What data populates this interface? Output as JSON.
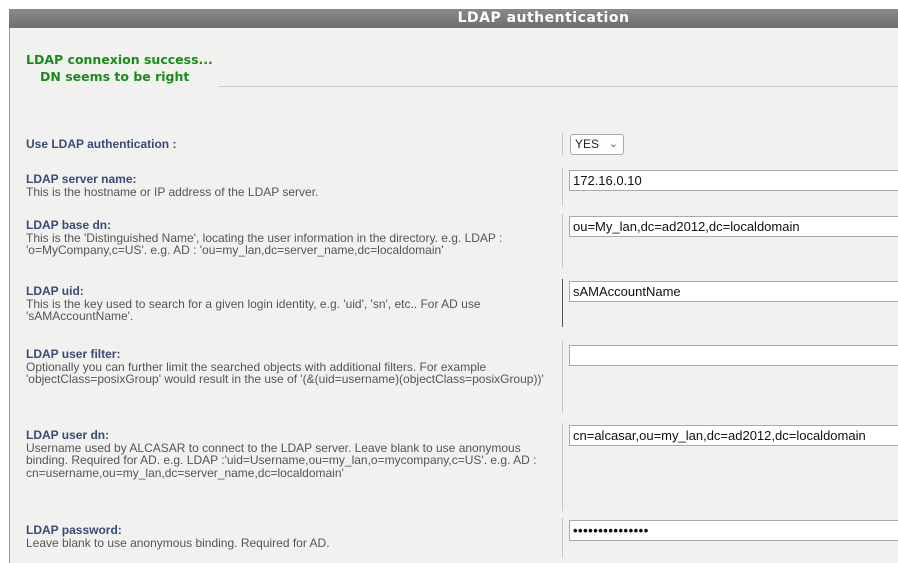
{
  "window": {
    "title": "LDAP authentication"
  },
  "status": {
    "line1": "LDAP connexion success...",
    "line2": "DN seems to be right"
  },
  "settings": [
    {
      "title": "Use LDAP authentication :",
      "description": "",
      "control": "select",
      "value": "YES"
    },
    {
      "title": "LDAP server name:",
      "description": "This is the hostname or IP address of the LDAP server.",
      "control": "text",
      "value": "172.16.0.10"
    },
    {
      "title": "LDAP base dn:",
      "description": "This is the 'Distinguished Name', locating the user information in the directory. e.g. LDAP : 'o=MyCompany,c=US'. e.g. AD : 'ou=my_lan,dc=server_name,dc=localdomain'",
      "control": "text",
      "value": "ou=My_lan,dc=ad2012,dc=localdomain"
    },
    {
      "title": "LDAP uid:",
      "description": "This is the key used to search for a given login identity, e.g. 'uid', 'sn', etc.. For AD use 'sAMAccountName'.",
      "control": "text",
      "value": "sAMAccountName"
    },
    {
      "title": "LDAP user filter:",
      "description": "Optionally you can further limit the searched objects with additional filters. For example 'objectClass=posixGroup' would result in the use of '(&(uid=username)(objectClass=posixGroup))'",
      "control": "text",
      "value": ""
    },
    {
      "title": "LDAP user dn:",
      "description": "Username used by ALCASAR to connect to the LDAP server. Leave blank to use anonymous binding. Required for AD. e.g. LDAP :'uid=Username,ou=my_lan,o=mycompany,c=US'. e.g. AD : cn=username,ou=my_lan,dc=server_name,dc=localdomain'",
      "control": "text",
      "value": "cn=alcasar,ou=my_lan,dc=ad2012,dc=localdomain"
    },
    {
      "title": "LDAP password:",
      "description": "Leave blank to use anonymous binding. Required for AD.",
      "control": "password",
      "value": "•••••••••••••••"
    }
  ]
}
